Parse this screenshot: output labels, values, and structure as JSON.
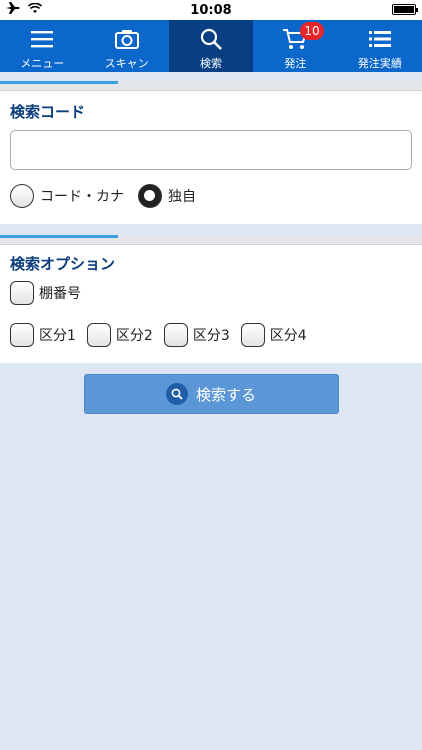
{
  "status_bar": {
    "time": "10:08"
  },
  "tabs": [
    {
      "label": "メニュー",
      "icon": "menu-icon",
      "active": false
    },
    {
      "label": "スキャン",
      "icon": "camera-icon",
      "active": false
    },
    {
      "label": "検索",
      "icon": "search-icon",
      "active": true
    },
    {
      "label": "発注",
      "icon": "cart-icon",
      "active": false,
      "badge": "10"
    },
    {
      "label": "発注実績",
      "icon": "list-icon",
      "active": false
    }
  ],
  "search_code": {
    "title": "検索コード",
    "input_value": "",
    "options": [
      {
        "label": "コード・カナ",
        "checked": false
      },
      {
        "label": "独自",
        "checked": true
      }
    ]
  },
  "search_options": {
    "title": "検索オプション",
    "shelf": {
      "label": "棚番号",
      "checked": false
    },
    "categories": [
      {
        "label": "区分1",
        "checked": false
      },
      {
        "label": "区分2",
        "checked": false
      },
      {
        "label": "区分3",
        "checked": false
      },
      {
        "label": "区分4",
        "checked": false
      }
    ]
  },
  "search_button": {
    "label": "検索する"
  },
  "colors": {
    "tabbar": "#0b67c9",
    "tab_active": "#073f82",
    "badge": "#e8262a",
    "title": "#0b3c7b",
    "button": "#5b97d6",
    "background": "#dde6f3"
  }
}
